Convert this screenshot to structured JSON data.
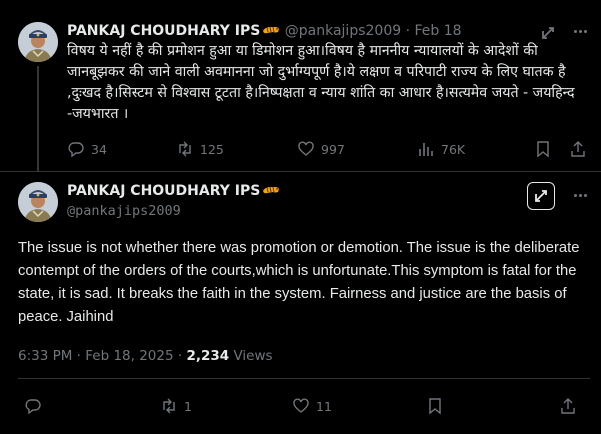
{
  "post1": {
    "author_name": "PANKAJ CHOUDHARY IPS",
    "handle": "@pankajips2009",
    "separator": "·",
    "date": "Feb 18",
    "text": "विषय ये नहीं है की प्रमोशन हुआ या डिमोशन हुआ।विषय है माननीय न्यायालयों के आदेशों की जानबूझकर की जाने वाली अवमानना जो दुर्भाग्यपूर्ण है।ये लक्षण व परिपाटी राज्य के लिए घातक है ,दुःखद है।सिस्टम से विश्वास टूटता है।निष्पक्षता व न्याय शांति का आधार है।सत्यमेव जयते - जयहिन्द -जयभारत ।",
    "replies": "34",
    "reposts": "125",
    "likes": "997",
    "views": "76K"
  },
  "post2": {
    "author_name": "PANKAJ CHOUDHARY IPS",
    "handle": "@pankajips2009",
    "text": "The issue is not whether there was promotion or demotion. The issue is the deliberate contempt of the orders of the courts,which is unfortunate.This symptom is fatal for the state, it is sad. It breaks the faith in the system. Fairness and justice are the basis of peace. Jaihind",
    "timestamp": "6:33 PM · Feb 18, 2025 ·",
    "view_count": "2,234",
    "views_label": "Views",
    "reposts": "1",
    "likes": "11"
  },
  "icons": {
    "reply": "reply-bubble-icon",
    "repost": "repost-arrows-icon",
    "like": "heart-icon",
    "views": "bar-chart-icon",
    "bookmark": "bookmark-icon",
    "share": "share-upload-icon",
    "grok": "grok-icon",
    "more": "more-dots-icon",
    "emoji": "tiger-emoji"
  },
  "colors": {
    "background": "#000000",
    "text": "#e7e9ea",
    "muted": "#71767b",
    "divider": "#2f3336",
    "emoji": "#f4a300"
  }
}
